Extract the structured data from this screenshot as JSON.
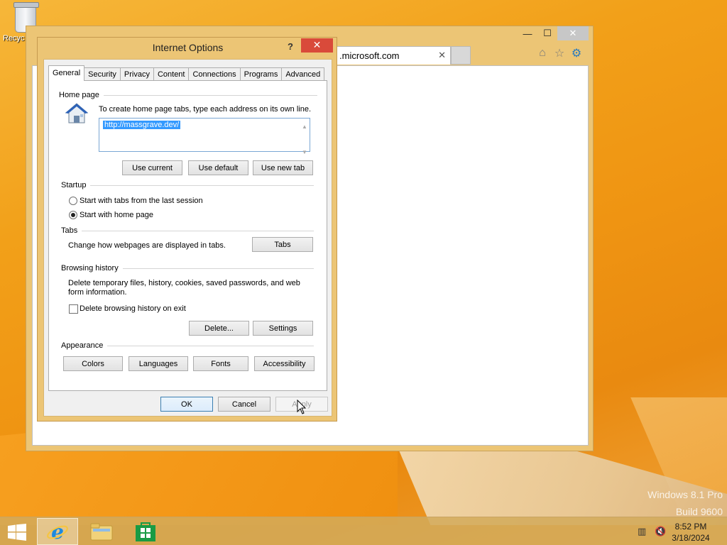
{
  "desktop": {
    "recycle_bin_label": "Recyc"
  },
  "ie": {
    "tab_title": ".microsoft.com",
    "tab_close": "✕",
    "window_controls": {
      "minimize": "—",
      "maximize": "☐",
      "close": "✕"
    }
  },
  "dialog": {
    "title": "Internet Options",
    "help": "?",
    "close": "✕",
    "tabs": [
      "General",
      "Security",
      "Privacy",
      "Content",
      "Connections",
      "Programs",
      "Advanced"
    ],
    "home_page": {
      "heading": "Home page",
      "instruction": "To create home page tabs, type each address on its own line.",
      "url": "http://massgrave.dev/",
      "buttons": {
        "use_current": "Use current",
        "use_default": "Use default",
        "use_new_tab": "Use new tab"
      }
    },
    "startup": {
      "heading": "Startup",
      "option_last_session": "Start with tabs from the last session",
      "option_home_page": "Start with home page",
      "selected": "home_page"
    },
    "tabs_section": {
      "heading": "Tabs",
      "description": "Change how webpages are displayed in tabs.",
      "button": "Tabs"
    },
    "browsing_history": {
      "heading": "Browsing history",
      "description_line1": "Delete temporary files, history, cookies, saved passwords, and web",
      "description_line2": "form information.",
      "delete_on_exit_label": "Delete browsing history on exit",
      "delete_on_exit_checked": false,
      "buttons": {
        "delete": "Delete...",
        "settings": "Settings"
      }
    },
    "appearance": {
      "heading": "Appearance",
      "buttons": {
        "colors": "Colors",
        "languages": "Languages",
        "fonts": "Fonts",
        "accessibility": "Accessibility"
      }
    },
    "footer": {
      "ok": "OK",
      "cancel": "Cancel",
      "apply": "Apply"
    }
  },
  "taskbar": {
    "time": "8:52 PM",
    "date": "3/18/2024"
  },
  "watermark": {
    "line1": "Windows 8.1 Pro",
    "line2": "Build 9600"
  },
  "colors": {
    "accent": "#ecc575",
    "close_red": "#d94a3a",
    "selection_blue": "#3399ff"
  }
}
